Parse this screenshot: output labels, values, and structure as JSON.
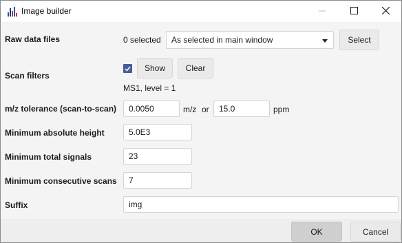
{
  "window": {
    "title": "Image builder",
    "controls": {
      "minimize": "minimize-icon",
      "maximize": "maximize-icon",
      "close": "close-icon"
    }
  },
  "raw_data": {
    "label": "Raw data files",
    "selected_count": "0 selected",
    "dropdown_value": "As selected in main window",
    "select_button": "Select"
  },
  "scan_filters": {
    "label": "Scan filters",
    "checked": true,
    "show_button": "Show",
    "clear_button": "Clear",
    "summary": "MS1, level = 1"
  },
  "mz_tolerance": {
    "label": "m/z tolerance (scan-to-scan)",
    "mz_value": "0.0050",
    "mz_unit": "m/z",
    "or_text": "or",
    "ppm_value": "15.0",
    "ppm_unit": "ppm"
  },
  "min_abs_height": {
    "label": "Minimum absolute height",
    "value": "5.0E3"
  },
  "min_total_signals": {
    "label": "Minimum total signals",
    "value": "23"
  },
  "min_consecutive_scans": {
    "label": "Minimum consecutive scans",
    "value": "7"
  },
  "suffix": {
    "label": "Suffix",
    "value": "img"
  },
  "footer": {
    "ok": "OK",
    "cancel": "Cancel"
  },
  "colors": {
    "checkbox": "#4a5c96",
    "ok_button_bg": "#cfcfcf"
  }
}
